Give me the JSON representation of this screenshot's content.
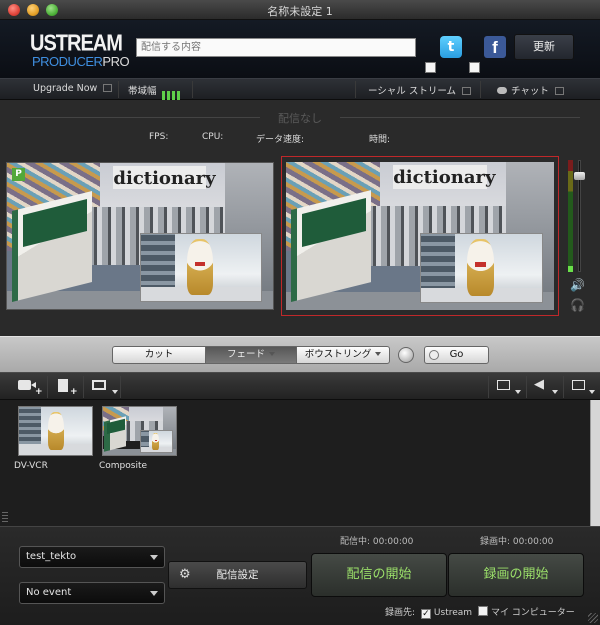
{
  "window": {
    "title": "名称未設定 1"
  },
  "header": {
    "logo_top": "USTREAM",
    "logo_bottom_a": "PRODUCER",
    "logo_bottom_b": "PRO",
    "status_placeholder": "配信する内容",
    "twitter_icon": "t",
    "facebook_icon": "f",
    "update_label": "更新"
  },
  "nav": {
    "upgrade_label": "Upgrade Now",
    "bandwidth_label": "帯域幅",
    "social_label": "ーシャル ストリーム",
    "chat_label": "チャット"
  },
  "monitor": {
    "status": "配信なし",
    "fps_label": "FPS:",
    "cpu_label": "CPU:",
    "datarate_label": "データ速度:",
    "time_label": "時間:",
    "preview_badge": "P",
    "sign_text": "dictionary"
  },
  "transition": {
    "cut_label": "カット",
    "fade_label": "フェード",
    "wipe_label": "ボウストリング",
    "go_label": "Go"
  },
  "sources": {
    "items": [
      {
        "label": "DV-VCR"
      },
      {
        "label": "Composite"
      }
    ]
  },
  "bottom": {
    "channel_value": "test_tekto",
    "event_value": "No event",
    "broadcast_settings_label": "配信設定",
    "broadcasting_time": "配信中: 00:00:00",
    "recording_time": "録画中: 00:00:00",
    "start_broadcast_label": "配信の開始",
    "start_record_label": "録画の開始",
    "record_to_label": "録画先:",
    "record_ustream_label": "Ustream",
    "record_mycomputer_label": "マイ コンピューター",
    "record_ustream_checked": true,
    "record_mycomputer_checked": false
  },
  "colors": {
    "accent_green": "#9be06a",
    "brand_blue": "#3f8fe0",
    "program_border": "#c0282a"
  }
}
